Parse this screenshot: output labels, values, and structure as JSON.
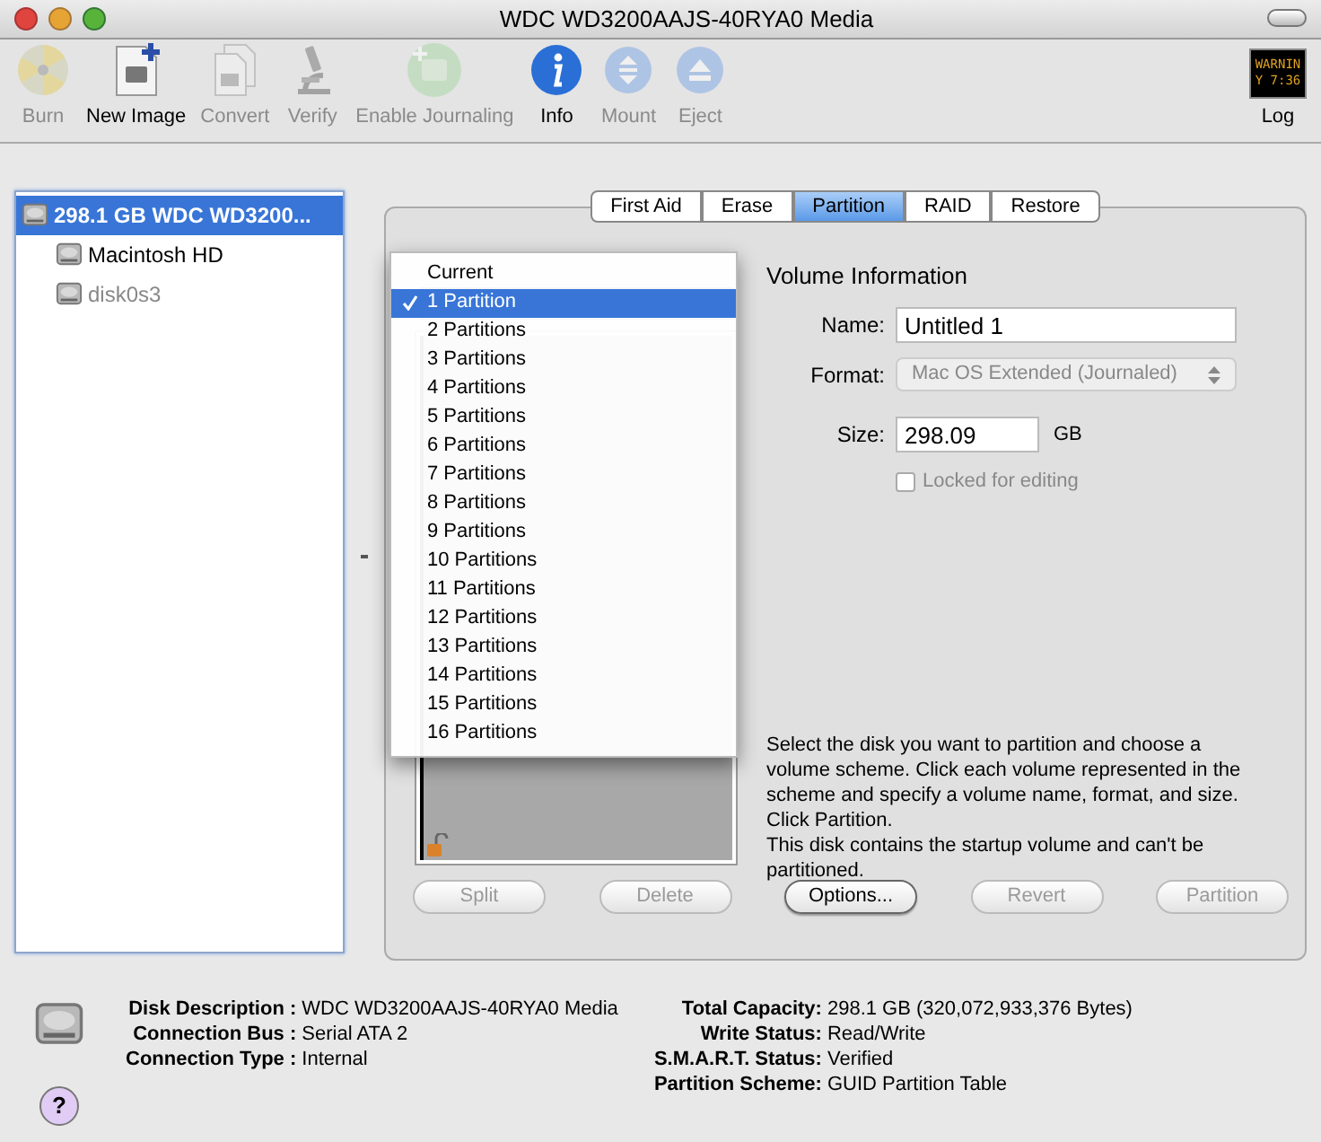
{
  "window": {
    "title": "WDC WD3200AAJS-40RYA0 Media"
  },
  "toolbar": [
    {
      "label": "Burn",
      "kind": "burn",
      "disabled": true
    },
    {
      "label": "New Image",
      "kind": "newimage",
      "disabled": false
    },
    {
      "label": "Convert",
      "kind": "convert",
      "disabled": true
    },
    {
      "label": "Verify",
      "kind": "verify",
      "disabled": true
    },
    {
      "label": "Enable Journaling",
      "kind": "journal",
      "disabled": true
    },
    {
      "label": "Info",
      "kind": "info",
      "disabled": false
    },
    {
      "label": "Mount",
      "kind": "mount",
      "disabled": true
    },
    {
      "label": "Eject",
      "kind": "eject",
      "disabled": true
    }
  ],
  "log": {
    "label": "Log",
    "screen_text": [
      "WARNIN",
      "Y 7:36"
    ]
  },
  "sidebar": {
    "items": [
      {
        "label": "298.1 GB WDC WD3200...",
        "selected": true,
        "children": [
          {
            "label": "Macintosh HD",
            "selected": false,
            "disabled": false
          },
          {
            "label": "disk0s3",
            "selected": false,
            "disabled": true
          }
        ]
      }
    ]
  },
  "tabs": [
    {
      "label": "First Aid",
      "selected": false
    },
    {
      "label": "Erase",
      "selected": false
    },
    {
      "label": "Partition",
      "selected": true
    },
    {
      "label": "RAID",
      "selected": false
    },
    {
      "label": "Restore",
      "selected": false
    }
  ],
  "scheme_menu": [
    {
      "label": "Current",
      "selected": false,
      "checked": false
    },
    {
      "label": "1 Partition",
      "selected": true,
      "checked": true
    },
    {
      "label": "2 Partitions",
      "selected": false,
      "checked": false
    },
    {
      "label": "3 Partitions",
      "selected": false,
      "checked": false
    },
    {
      "label": "4 Partitions",
      "selected": false,
      "checked": false
    },
    {
      "label": "5 Partitions",
      "selected": false,
      "checked": false
    },
    {
      "label": "6 Partitions",
      "selected": false,
      "checked": false
    },
    {
      "label": "7 Partitions",
      "selected": false,
      "checked": false
    },
    {
      "label": "8 Partitions",
      "selected": false,
      "checked": false
    },
    {
      "label": "9 Partitions",
      "selected": false,
      "checked": false
    },
    {
      "label": "10 Partitions",
      "selected": false,
      "checked": false
    },
    {
      "label": "11 Partitions",
      "selected": false,
      "checked": false
    },
    {
      "label": "12 Partitions",
      "selected": false,
      "checked": false
    },
    {
      "label": "13 Partitions",
      "selected": false,
      "checked": false
    },
    {
      "label": "14 Partitions",
      "selected": false,
      "checked": false
    },
    {
      "label": "15 Partitions",
      "selected": false,
      "checked": false
    },
    {
      "label": "16 Partitions",
      "selected": false,
      "checked": false
    }
  ],
  "volume_info": {
    "title": "Volume Information",
    "name": {
      "label": "Name:",
      "value": "Untitled 1"
    },
    "format": {
      "label": "Format:",
      "value": "Mac OS Extended (Journaled)",
      "disabled": true
    },
    "size": {
      "label": "Size:",
      "value": "298.09",
      "unit": "GB"
    },
    "locked": {
      "label": "Locked for editing",
      "checked": false,
      "disabled": true
    },
    "description": "Select the disk you want to partition and choose a volume scheme. Click each volume represented in the scheme and specify a volume name, format, and size. Click Partition.",
    "warning": "This disk contains the startup volume and can't be partitioned."
  },
  "buttons": [
    {
      "label": "Split",
      "disabled": true
    },
    {
      "label": "Delete",
      "disabled": true
    },
    {
      "label": "Options...",
      "disabled": false
    },
    {
      "label": "Revert",
      "disabled": true
    },
    {
      "label": "Partition",
      "disabled": true
    }
  ],
  "info_left": [
    {
      "label": "Disk Description",
      "value": "WDC WD3200AAJS-40RYA0 Media"
    },
    {
      "label": "Connection Bus",
      "value": "Serial ATA 2"
    },
    {
      "label": "Connection Type",
      "value": "Internal"
    }
  ],
  "info_right": [
    {
      "label": "Total Capacity",
      "value": "298.1 GB (320,072,933,376 Bytes)"
    },
    {
      "label": "Write Status",
      "value": "Read/Write"
    },
    {
      "label": "S.M.A.R.T. Status",
      "value": "Verified"
    },
    {
      "label": "Partition Scheme",
      "value": "GUID Partition Table"
    }
  ],
  "separator": ":",
  "help": "?"
}
